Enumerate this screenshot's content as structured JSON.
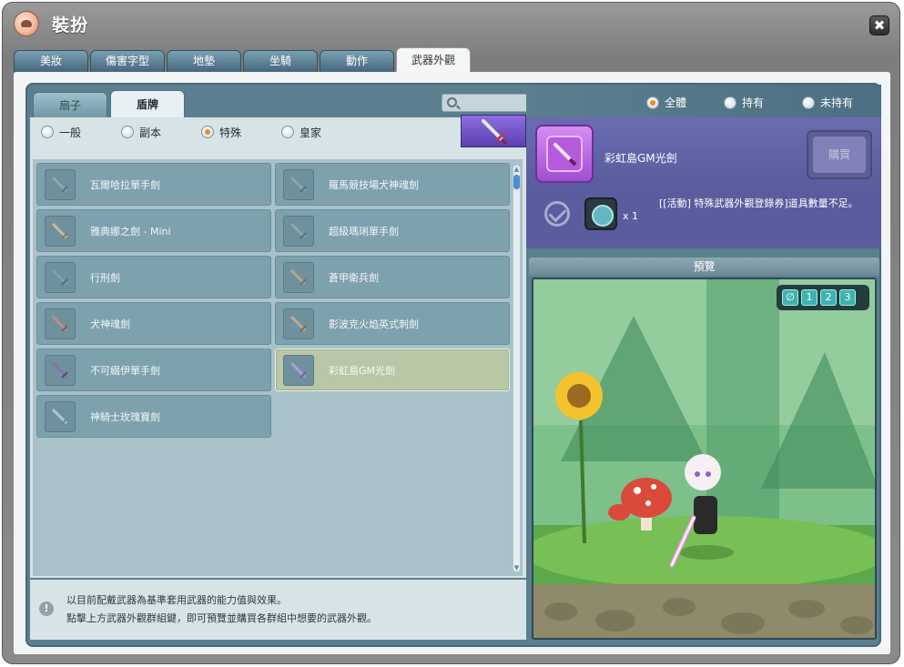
{
  "window": {
    "title": "裝扮",
    "close_label": "✖"
  },
  "top_tabs": [
    {
      "label": "美妝",
      "active": false
    },
    {
      "label": "傷害字型",
      "active": false
    },
    {
      "label": "地墊",
      "active": false
    },
    {
      "label": "坐騎",
      "active": false
    },
    {
      "label": "動作",
      "active": false
    },
    {
      "label": "武器外觀",
      "active": true
    }
  ],
  "sub_tabs": [
    {
      "label": "扇子",
      "active": false
    },
    {
      "label": "盾牌",
      "active": true
    }
  ],
  "search": {
    "placeholder": "",
    "value": ""
  },
  "type_filter": [
    {
      "label": "一般",
      "checked": false
    },
    {
      "label": "副本",
      "checked": false
    },
    {
      "label": "特殊",
      "checked": true
    },
    {
      "label": "皇家",
      "checked": false
    }
  ],
  "owner_filter": [
    {
      "label": "全體",
      "checked": true
    },
    {
      "label": "持有",
      "checked": false
    },
    {
      "label": "未持有",
      "checked": false
    }
  ],
  "items": [
    {
      "name": "瓦爾哈拉單手劍",
      "selected": false
    },
    {
      "name": "羅馬競技場犬神魂劍",
      "selected": false
    },
    {
      "name": "雅典娜之劍 - Mini",
      "selected": false
    },
    {
      "name": "超級瑪琍單手劍",
      "selected": false
    },
    {
      "name": "行刑劍",
      "selected": false
    },
    {
      "name": "蒼甲衛兵劍",
      "selected": false
    },
    {
      "name": "犬神魂劍",
      "selected": false
    },
    {
      "name": "影波克火焰英式刺劍",
      "selected": false
    },
    {
      "name": "不可綴伊單手劍",
      "selected": false
    },
    {
      "name": "彩虹島GM光劍",
      "selected": true
    },
    {
      "name": "神騎士玫瑰寶劍",
      "selected": false
    }
  ],
  "detail": {
    "weapon_name": "彩虹島GM光劍",
    "buy_label": "購買",
    "coupon_qty": "x 1",
    "coupon_message": "[[活動] 特殊武器外觀登錄券]道具數量不足。"
  },
  "preview": {
    "label": "預覽",
    "controls": [
      "∅",
      "1",
      "2",
      "3"
    ]
  },
  "info": {
    "icon": "!",
    "line1": "以目前配戴武器為基準套用武器的能力值與效果。",
    "line2": "點擊上方武器外觀群組鍵，即可預覽並購買各群組中想要的武器外觀。"
  }
}
